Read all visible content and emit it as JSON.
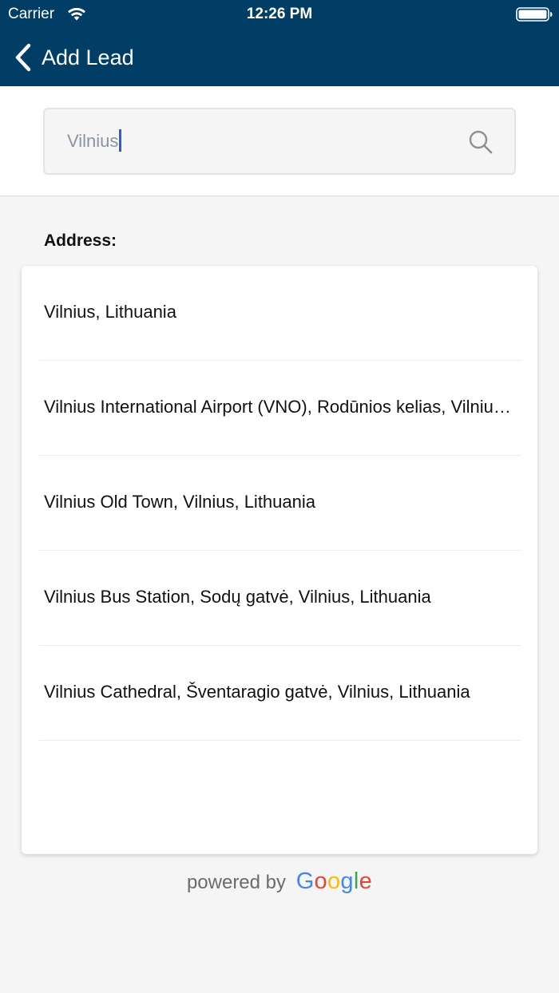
{
  "status_bar": {
    "carrier": "Carrier",
    "time": "12:26 PM"
  },
  "nav": {
    "back_label": "Add Lead"
  },
  "search": {
    "value": "Vilnius"
  },
  "address_label": "Address:",
  "results": [
    "Vilnius, Lithuania",
    "Vilnius International Airport (VNO), Rodūnios kelias, Vilnius, Lithuania",
    "Vilnius Old Town, Vilnius, Lithuania",
    "Vilnius Bus Station, Sodų gatvė, Vilnius, Lithuania",
    "Vilnius Cathedral, Šventaragio gatvė, Vilnius, Lithuania"
  ],
  "footer": {
    "powered_by": "powered by",
    "google": [
      "G",
      "o",
      "o",
      "g",
      "l",
      "e"
    ]
  },
  "colors": {
    "nav_background": "#003e66",
    "caret": "#2f5bd9",
    "google_blue": "#4285F4",
    "google_red": "#EA4335",
    "google_yellow": "#FBBC05",
    "google_green": "#34A853"
  }
}
